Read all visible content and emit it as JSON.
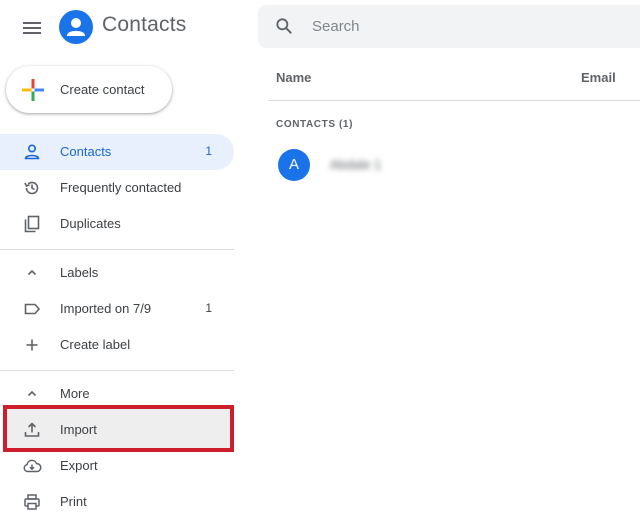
{
  "app": {
    "title": "Contacts",
    "brand_color": "#1a73e8"
  },
  "search": {
    "placeholder": "Search",
    "value": ""
  },
  "create_contact": {
    "label": "Create contact"
  },
  "sidebar": {
    "items": [
      {
        "label": "Contacts",
        "count": "1",
        "icon": "person-icon",
        "active": true
      },
      {
        "label": "Frequently contacted",
        "count": "",
        "icon": "history-icon",
        "active": false
      },
      {
        "label": "Duplicates",
        "count": "",
        "icon": "duplicates-icon",
        "active": false
      }
    ],
    "labels_section": {
      "header": "Labels",
      "items": [
        {
          "label": "Imported on 7/9",
          "count": "1",
          "icon": "label-icon"
        },
        {
          "label": "Create label",
          "count": "",
          "icon": "plus-icon"
        }
      ]
    },
    "more_section": {
      "header": "More",
      "items": [
        {
          "label": "Import",
          "icon": "upload-icon"
        },
        {
          "label": "Export",
          "icon": "cloud-download-icon"
        },
        {
          "label": "Print",
          "icon": "print-icon"
        }
      ]
    }
  },
  "table": {
    "columns": [
      "Name",
      "Email"
    ],
    "section_label": "CONTACTS (1)",
    "rows": [
      {
        "avatar_letter": "A",
        "name": "Abdale 1",
        "avatar_color": "#1a73e8"
      }
    ]
  },
  "annotation": {
    "highlight_color": "#cc1f2b"
  }
}
